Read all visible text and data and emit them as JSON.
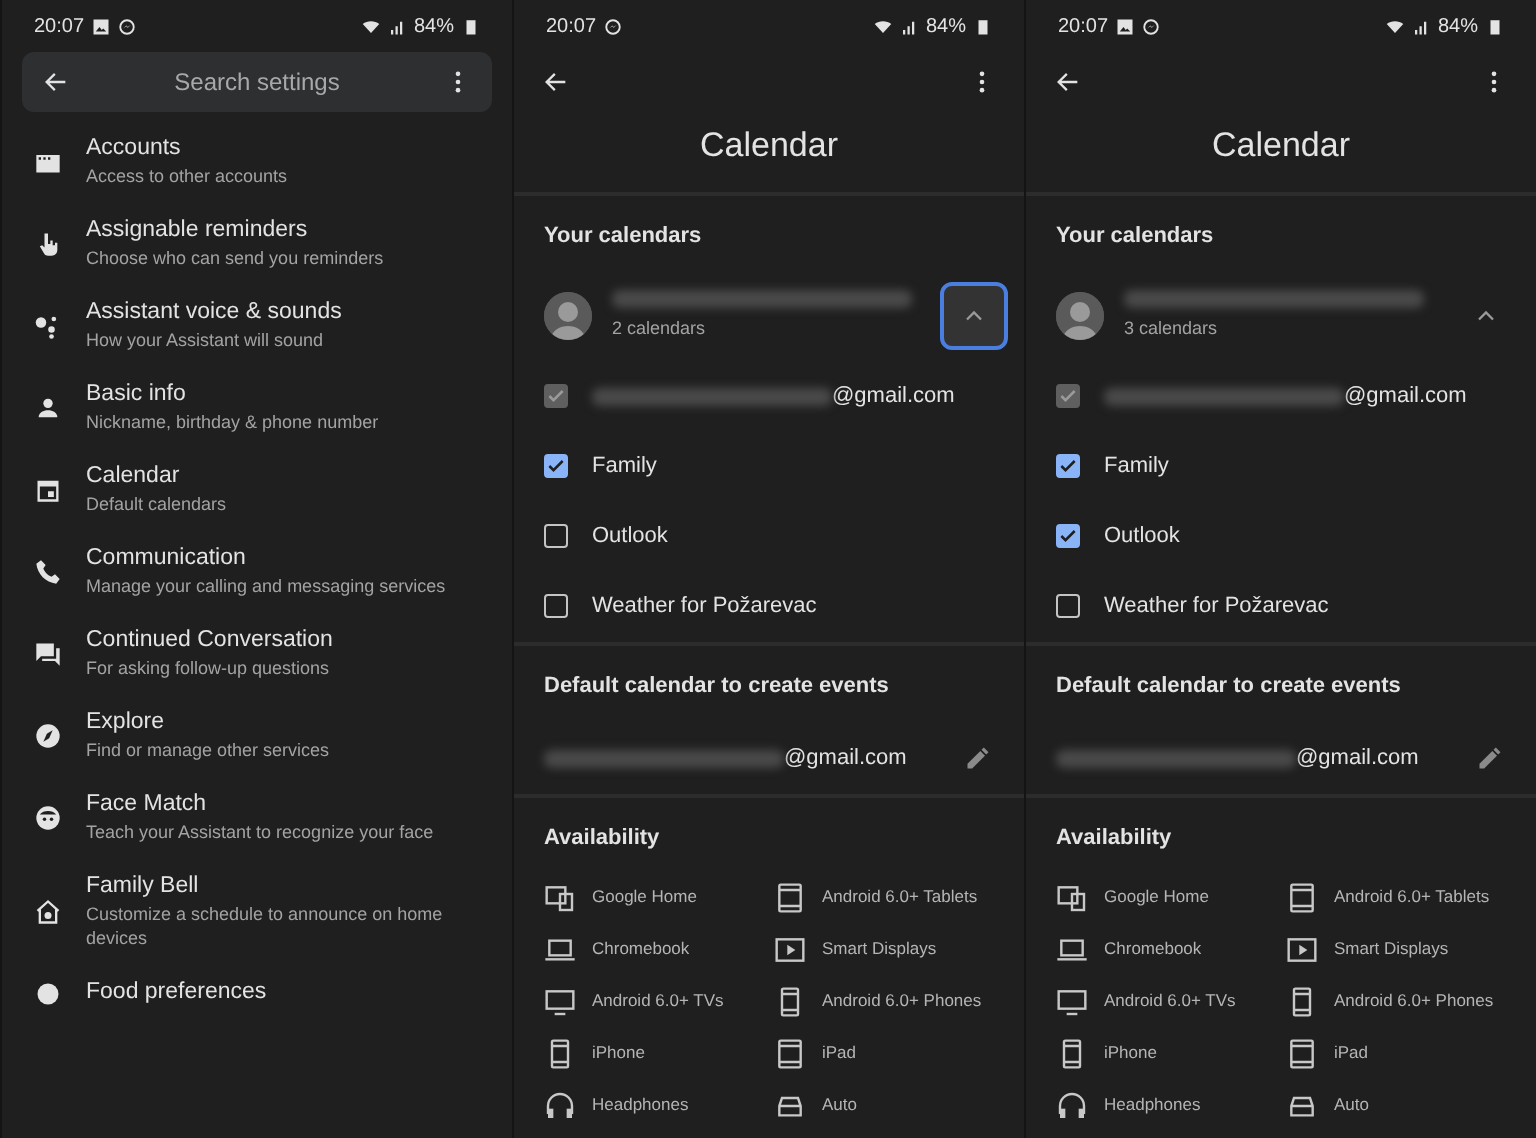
{
  "panels": [
    {
      "kind": "settings",
      "status_bar": {
        "time": "20:07",
        "battery": "84%"
      },
      "search": {
        "placeholder": "Search settings"
      },
      "items": [
        {
          "title": "Accounts",
          "subtitle": "Access to other accounts"
        },
        {
          "title": "Assignable reminders",
          "subtitle": "Choose who can send you reminders"
        },
        {
          "title": "Assistant voice & sounds",
          "subtitle": "How your Assistant will sound"
        },
        {
          "title": "Basic info",
          "subtitle": "Nickname, birthday & phone number"
        },
        {
          "title": "Calendar",
          "subtitle": "Default calendars"
        },
        {
          "title": "Communication",
          "subtitle": "Manage your calling and messaging services"
        },
        {
          "title": "Continued Conversation",
          "subtitle": "For asking follow-up questions"
        },
        {
          "title": "Explore",
          "subtitle": "Find or manage other services"
        },
        {
          "title": "Face Match",
          "subtitle": "Teach your Assistant to recognize your face"
        },
        {
          "title": "Family Bell",
          "subtitle": "Customize a schedule to announce on home devices"
        },
        {
          "title": "Food preferences"
        }
      ]
    },
    {
      "kind": "calendar",
      "status_bar": {
        "time": "20:07",
        "battery": "84%"
      },
      "title": "Calendar",
      "your_calendars": {
        "heading": "Your calendars",
        "account": {
          "subtitle": "2 calendars",
          "expanded": true,
          "focused": true
        },
        "calendars": [
          {
            "label": "@gmail.com",
            "checked": true,
            "disabled": true
          },
          {
            "label": "Family",
            "checked": true,
            "disabled": false
          },
          {
            "label": "Outlook",
            "checked": false,
            "disabled": false
          },
          {
            "label": "Weather for Požarevac",
            "checked": false,
            "disabled": false
          }
        ]
      },
      "default_calendar": {
        "heading": "Default calendar to create events",
        "value": "@gmail.com"
      },
      "availability": {
        "heading": "Availability",
        "devices": [
          {
            "kind": "home",
            "label": "Google Home"
          },
          {
            "kind": "tablet",
            "label": "Android 6.0+ Tablets"
          },
          {
            "kind": "laptop",
            "label": "Chromebook"
          },
          {
            "kind": "display",
            "label": "Smart Displays"
          },
          {
            "kind": "tv",
            "label": "Android 6.0+ TVs"
          },
          {
            "kind": "phone",
            "label": "Android 6.0+ Phones"
          },
          {
            "kind": "phone",
            "label": "iPhone"
          },
          {
            "kind": "tablet",
            "label": "iPad"
          },
          {
            "kind": "headphones",
            "label": "Headphones"
          },
          {
            "kind": "car",
            "label": "Auto"
          }
        ]
      }
    },
    {
      "kind": "calendar",
      "status_bar": {
        "time": "20:07",
        "battery": "84%"
      },
      "title": "Calendar",
      "your_calendars": {
        "heading": "Your calendars",
        "account": {
          "subtitle": "3 calendars",
          "expanded": true,
          "focused": false
        },
        "calendars": [
          {
            "label": "@gmail.com",
            "checked": true,
            "disabled": true
          },
          {
            "label": "Family",
            "checked": true,
            "disabled": false
          },
          {
            "label": "Outlook",
            "checked": true,
            "disabled": false
          },
          {
            "label": "Weather for Požarevac",
            "checked": false,
            "disabled": false
          }
        ]
      },
      "default_calendar": {
        "heading": "Default calendar to create events",
        "value": "@gmail.com"
      },
      "availability": {
        "heading": "Availability",
        "devices": [
          {
            "kind": "home",
            "label": "Google Home"
          },
          {
            "kind": "tablet",
            "label": "Android 6.0+ Tablets"
          },
          {
            "kind": "laptop",
            "label": "Chromebook"
          },
          {
            "kind": "display",
            "label": "Smart Displays"
          },
          {
            "kind": "tv",
            "label": "Android 6.0+ TVs"
          },
          {
            "kind": "phone",
            "label": "Android 6.0+ Phones"
          },
          {
            "kind": "phone",
            "label": "iPhone"
          },
          {
            "kind": "tablet",
            "label": "iPad"
          },
          {
            "kind": "headphones",
            "label": "Headphones"
          },
          {
            "kind": "car",
            "label": "Auto"
          }
        ]
      }
    }
  ]
}
